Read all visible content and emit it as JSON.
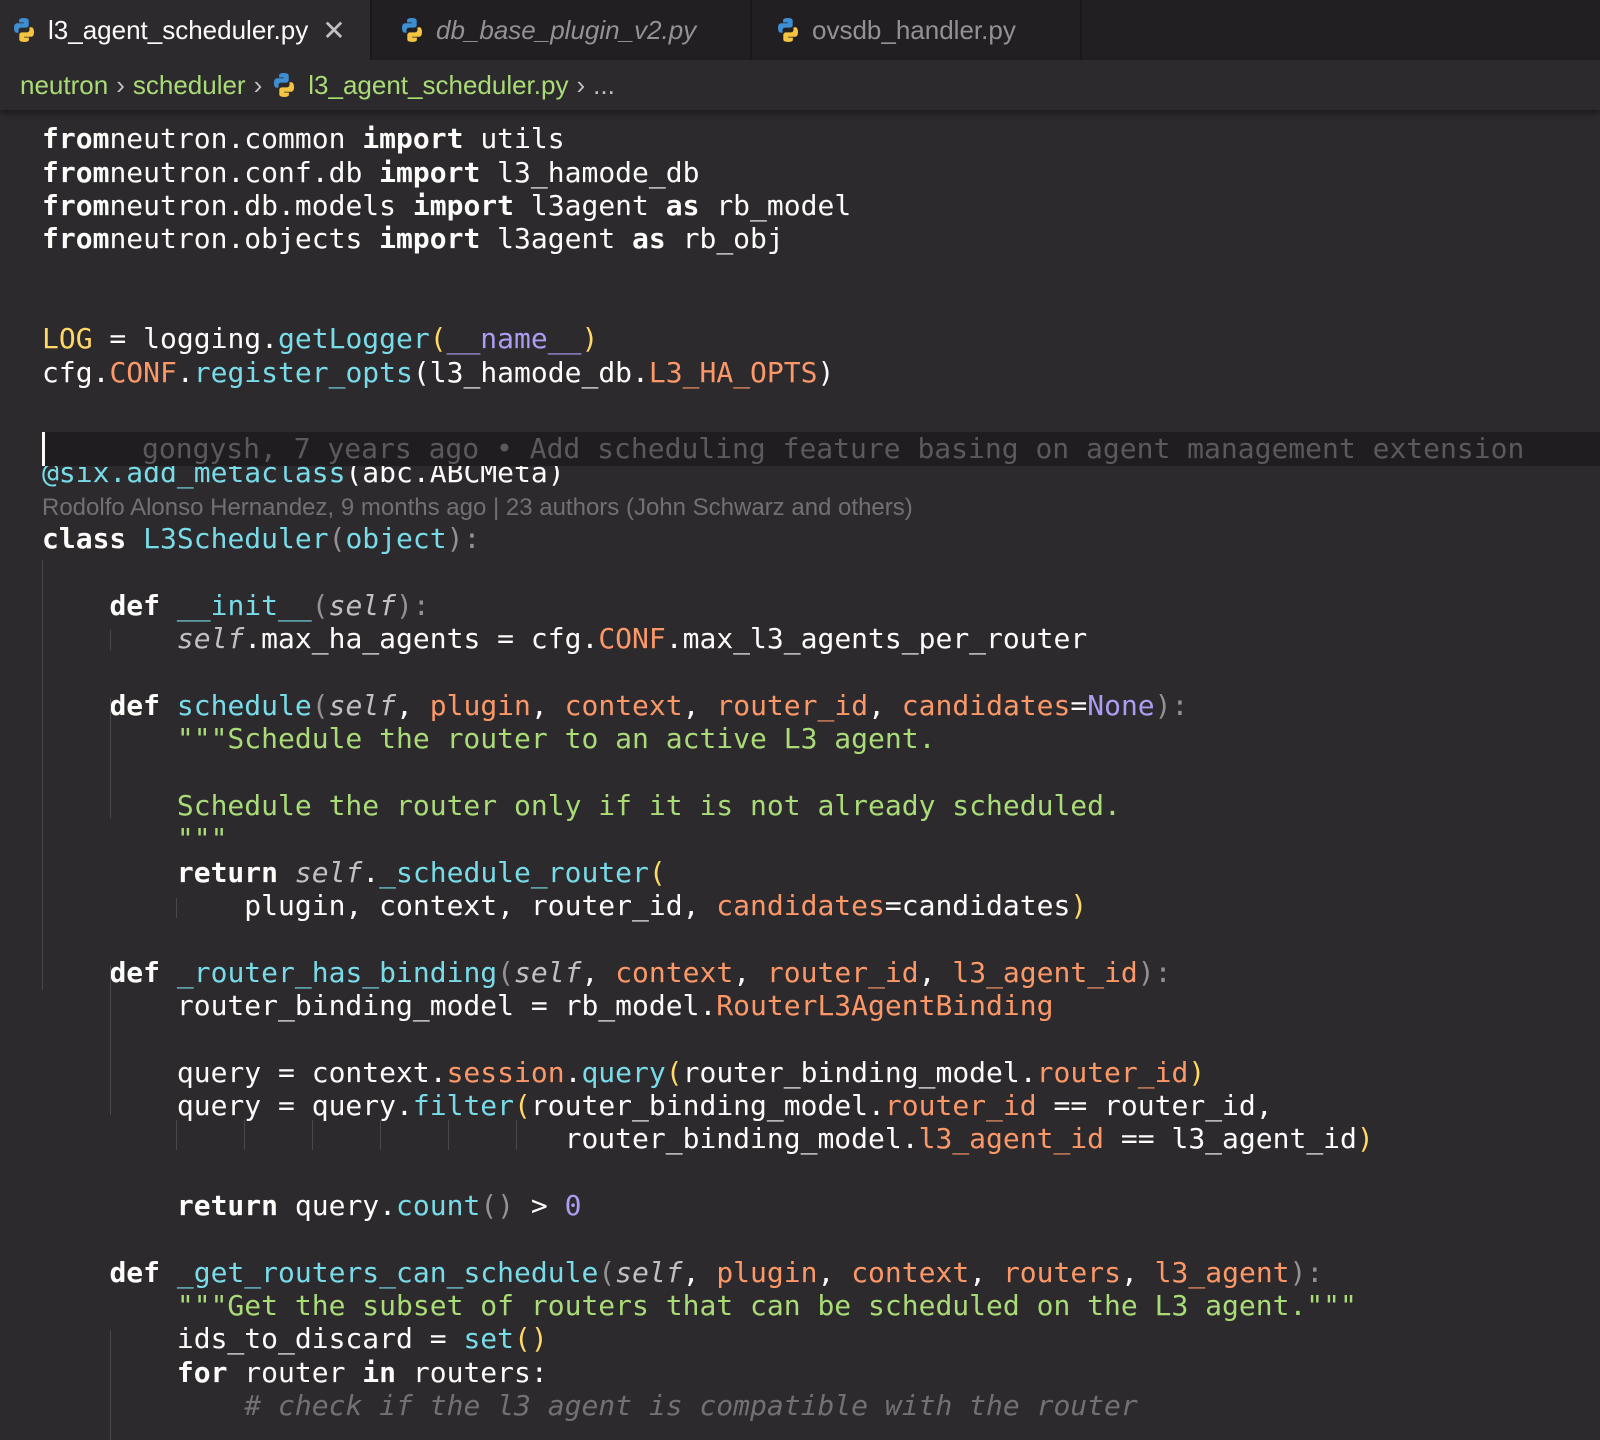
{
  "tabs": [
    {
      "label": "l3_agent_scheduler.py",
      "active": true,
      "italic": false
    },
    {
      "label": "db_base_plugin_v2.py",
      "active": false,
      "italic": true
    },
    {
      "label": "ovsdb_handler.py",
      "active": false,
      "italic": false
    }
  ],
  "breadcrumb": {
    "items": [
      "neutron",
      "scheduler",
      "l3_agent_scheduler.py"
    ],
    "ellipsis": "..."
  },
  "blame": {
    "inline": "gongysh, 7 years ago • Add scheduling feature basing on agent management extension",
    "codelens": "Rodolfo Alonso Hernandez, 9 months ago | 23 authors (John Schwarz and others)"
  },
  "icons": {
    "file_icon": "python-icon",
    "close": "close-icon",
    "chevron": "chevron-right-icon"
  },
  "colors": {
    "keyword": "#fcfcfa",
    "function": "#78dce8",
    "param": "#fc9867",
    "string": "#a9dc76",
    "constant": "#ab9df2",
    "background": "#2d2a2e"
  },
  "code": [
    [
      [
        "kw",
        "from"
      ],
      [
        "",
        "neutron.common "
      ],
      [
        "kw",
        "import"
      ],
      [
        "",
        " utils"
      ]
    ],
    [
      [
        "kw",
        "from"
      ],
      [
        "",
        "neutron.conf.db "
      ],
      [
        "kw",
        "import"
      ],
      [
        "",
        " l3_hamode_db"
      ]
    ],
    [
      [
        "kw",
        "from"
      ],
      [
        "",
        "neutron.db.models "
      ],
      [
        "kw",
        "import"
      ],
      [
        "",
        " l3agent "
      ],
      [
        "kw",
        "as"
      ],
      [
        "",
        " rb_model"
      ]
    ],
    [
      [
        "kw",
        "from"
      ],
      [
        "",
        "neutron.objects "
      ],
      [
        "kw",
        "import"
      ],
      [
        "",
        " l3agent "
      ],
      [
        "kw",
        "as"
      ],
      [
        "",
        " rb_obj"
      ]
    ],
    [],
    [],
    [
      [
        "yel",
        "LOG"
      ],
      [
        "",
        " = logging."
      ],
      [
        "fn",
        "getLogger"
      ],
      [
        "yel",
        "("
      ],
      [
        "dunder",
        "__name__"
      ],
      [
        "yel",
        ")"
      ]
    ],
    [
      [
        "",
        "cfg."
      ],
      [
        "attr",
        "CONF"
      ],
      [
        "",
        "."
      ],
      [
        "fn",
        "register_opts"
      ],
      [
        "",
        "(l3_hamode_db."
      ],
      [
        "attr",
        "L3_HA_OPTS"
      ],
      [
        "",
        ")"
      ]
    ],
    [],
    [
      [
        "fn",
        "@six.add_metaclass"
      ],
      [
        "",
        "(abc.ABCMeta)"
      ]
    ],
    [
      [
        "kw",
        "class"
      ],
      [
        "",
        " "
      ],
      [
        "cls",
        "L3Scheduler"
      ],
      [
        "pun",
        "("
      ],
      [
        "cls",
        "object"
      ],
      [
        "pun",
        "):"
      ]
    ],
    [],
    [
      [
        "",
        "    "
      ],
      [
        "kw",
        "def"
      ],
      [
        "",
        " "
      ],
      [
        "fn",
        "__init__"
      ],
      [
        "pun",
        "("
      ],
      [
        "self",
        "self"
      ],
      [
        "pun",
        "):"
      ]
    ],
    [
      [
        "",
        "        "
      ],
      [
        "self",
        "self"
      ],
      [
        "",
        ".max_ha_agents = cfg."
      ],
      [
        "attr",
        "CONF"
      ],
      [
        "",
        ".max_l3_agents_per_router"
      ]
    ],
    [],
    [
      [
        "",
        "    "
      ],
      [
        "kw",
        "def"
      ],
      [
        "",
        " "
      ],
      [
        "fn",
        "schedule"
      ],
      [
        "pun",
        "("
      ],
      [
        "self",
        "self"
      ],
      [
        "",
        ", "
      ],
      [
        "par",
        "plugin"
      ],
      [
        "",
        ", "
      ],
      [
        "par",
        "context"
      ],
      [
        "",
        ", "
      ],
      [
        "par",
        "router_id"
      ],
      [
        "",
        ", "
      ],
      [
        "par",
        "candidates"
      ],
      [
        "op",
        "="
      ],
      [
        "cnst",
        "None"
      ],
      [
        "pun",
        "):"
      ]
    ],
    [
      [
        "",
        "        "
      ],
      [
        "str",
        "\"\"\"Schedule the router to an active L3 agent."
      ]
    ],
    [],
    [
      [
        "",
        "        "
      ],
      [
        "str",
        "Schedule the router only if it is not already scheduled."
      ]
    ],
    [
      [
        "",
        "        "
      ],
      [
        "str",
        "\"\"\""
      ]
    ],
    [
      [
        "",
        "        "
      ],
      [
        "kw",
        "return"
      ],
      [
        "",
        " "
      ],
      [
        "self",
        "self"
      ],
      [
        "",
        "."
      ],
      [
        "fn",
        "_schedule_router"
      ],
      [
        "yel",
        "("
      ]
    ],
    [
      [
        "",
        "            plugin, context, router_id, "
      ],
      [
        "par",
        "candidates"
      ],
      [
        "op",
        "="
      ],
      [
        "",
        "candidates"
      ],
      [
        "yel",
        ")"
      ]
    ],
    [],
    [
      [
        "",
        "    "
      ],
      [
        "kw",
        "def"
      ],
      [
        "",
        " "
      ],
      [
        "fn",
        "_router_has_binding"
      ],
      [
        "pun",
        "("
      ],
      [
        "self",
        "self"
      ],
      [
        "",
        ", "
      ],
      [
        "par",
        "context"
      ],
      [
        "",
        ", "
      ],
      [
        "par",
        "router_id"
      ],
      [
        "",
        ", "
      ],
      [
        "par",
        "l3_agent_id"
      ],
      [
        "pun",
        "):"
      ]
    ],
    [
      [
        "",
        "        router_binding_model = rb_model."
      ],
      [
        "attr",
        "RouterL3AgentBinding"
      ]
    ],
    [],
    [
      [
        "",
        "        query = context."
      ],
      [
        "attr",
        "session"
      ],
      [
        "",
        "."
      ],
      [
        "fn",
        "query"
      ],
      [
        "yel",
        "("
      ],
      [
        "",
        "router_binding_model."
      ],
      [
        "attr",
        "router_id"
      ],
      [
        "yel",
        ")"
      ]
    ],
    [
      [
        "",
        "        query = query."
      ],
      [
        "fn",
        "filter"
      ],
      [
        "yel",
        "("
      ],
      [
        "",
        "router_binding_model."
      ],
      [
        "attr",
        "router_id"
      ],
      [
        "",
        " == router_id,"
      ]
    ],
    [
      [
        "",
        "                               router_binding_model."
      ],
      [
        "attr",
        "l3_agent_id"
      ],
      [
        "",
        " == l3_agent_id"
      ],
      [
        "yel",
        ")"
      ]
    ],
    [],
    [
      [
        "",
        "        "
      ],
      [
        "kw",
        "return"
      ],
      [
        "",
        " query."
      ],
      [
        "fn",
        "count"
      ],
      [
        "pun",
        "()"
      ],
      [
        "",
        " > "
      ],
      [
        "num",
        "0"
      ]
    ],
    [],
    [
      [
        "",
        "    "
      ],
      [
        "kw",
        "def"
      ],
      [
        "",
        " "
      ],
      [
        "fn",
        "_get_routers_can_schedule"
      ],
      [
        "pun",
        "("
      ],
      [
        "self",
        "self"
      ],
      [
        "",
        ", "
      ],
      [
        "par",
        "plugin"
      ],
      [
        "",
        ", "
      ],
      [
        "par",
        "context"
      ],
      [
        "",
        ", "
      ],
      [
        "par",
        "routers"
      ],
      [
        "",
        ", "
      ],
      [
        "par",
        "l3_agent"
      ],
      [
        "pun",
        "):"
      ]
    ],
    [
      [
        "",
        "        "
      ],
      [
        "str",
        "\"\"\"Get the subset of routers that can be scheduled on the L3 agent.\"\"\""
      ]
    ],
    [
      [
        "",
        "        ids_to_discard = "
      ],
      [
        "fn",
        "set"
      ],
      [
        "yel",
        "()"
      ]
    ],
    [
      [
        "",
        "        "
      ],
      [
        "kw",
        "for"
      ],
      [
        "",
        " router "
      ],
      [
        "kw",
        "in"
      ],
      [
        "",
        " routers:"
      ]
    ],
    [
      [
        "",
        "            "
      ],
      [
        "cmt",
        "# check if the l3 agent is compatible with the router"
      ]
    ]
  ]
}
